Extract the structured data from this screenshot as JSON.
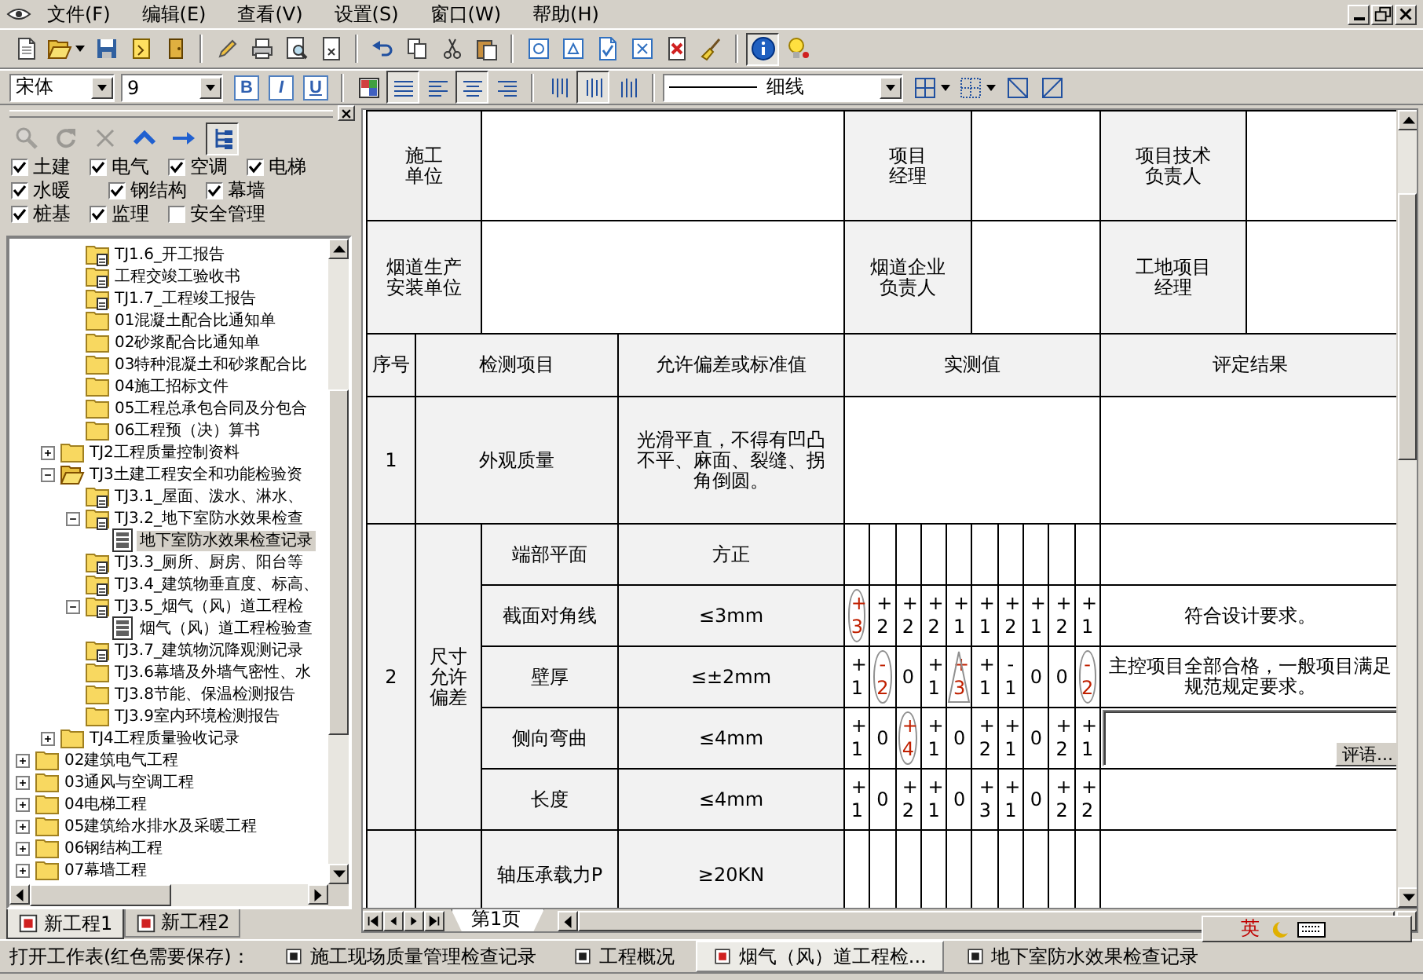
{
  "menu_bar": {
    "items": [
      "文件(F)",
      "编辑(E)",
      "查看(V)",
      "设置(S)",
      "窗口(W)",
      "帮助(H)"
    ]
  },
  "toolbar_main": {
    "groups": [
      [
        {
          "kind": "new-file",
          "pressed": false
        },
        {
          "kind": "open-folder",
          "pressed": false,
          "menu": true
        },
        {
          "kind": "save",
          "pressed": false
        },
        {
          "kind": "note",
          "pressed": false
        },
        {
          "kind": "exit-door",
          "pressed": false
        }
      ],
      [
        {
          "kind": "pencil",
          "pressed": false
        },
        {
          "kind": "print",
          "pressed": false
        },
        {
          "kind": "print-preview",
          "pressed": false
        },
        {
          "kind": "close-file",
          "pressed": false
        }
      ],
      [
        {
          "kind": "undo",
          "pressed": false
        },
        {
          "kind": "copy",
          "pressed": false
        },
        {
          "kind": "cut",
          "pressed": false
        },
        {
          "kind": "paste",
          "pressed": false
        }
      ],
      [
        {
          "kind": "circle-shape",
          "pressed": false
        },
        {
          "kind": "triangle-shape",
          "pressed": false
        },
        {
          "kind": "check-shape"
        },
        {
          "kind": "cross-shape",
          "pressed": false
        },
        {
          "kind": "delete-file",
          "pressed": false
        },
        {
          "kind": "broom",
          "pressed": false
        }
      ],
      [
        {
          "kind": "info",
          "pressed": true
        },
        {
          "kind": "lightbulb",
          "pressed": false
        }
      ]
    ]
  },
  "toolbar_format": {
    "font_box": {
      "value": "宋体"
    },
    "size_box": {
      "value": "9"
    },
    "style_buttons": [
      {
        "label": "B",
        "kind": "bold"
      },
      {
        "label": "I",
        "kind": "italic"
      },
      {
        "label": "U",
        "kind": "underline"
      }
    ],
    "groups": [
      [
        {
          "kind": "cell-color",
          "pressed": false
        },
        {
          "kind": "lines",
          "pressed": true
        },
        {
          "kind": "align-left",
          "pressed": false
        },
        {
          "kind": "align-center",
          "pressed": true
        },
        {
          "kind": "align-right",
          "pressed": false
        }
      ],
      [
        {
          "kind": "valign-top",
          "pressed": false
        },
        {
          "kind": "valign-middle",
          "pressed": true
        },
        {
          "kind": "valign-bottom",
          "pressed": false
        }
      ]
    ],
    "line_box": {
      "value": "细线"
    },
    "border_tools": [
      {
        "kind": "borders",
        "pressed": false,
        "menu": true
      },
      {
        "kind": "dotted-borders",
        "pressed": false,
        "menu": true
      },
      {
        "kind": "diagonal-down",
        "pressed": false
      },
      {
        "kind": "diagonal-up",
        "pressed": false
      }
    ]
  },
  "panel": {
    "tools": [
      {
        "kind": "search",
        "disabled": true,
        "pressed": false
      },
      {
        "kind": "refresh",
        "disabled": true,
        "pressed": false
      },
      {
        "kind": "close",
        "disabled": true,
        "pressed": false
      },
      {
        "kind": "up",
        "disabled": false,
        "pressed": false
      },
      {
        "kind": "forward",
        "disabled": false,
        "pressed": false
      },
      {
        "kind": "tree-view",
        "disabled": false,
        "pressed": true
      }
    ],
    "filter_rows": [
      [
        {
          "label": "土建",
          "checked": true
        },
        {
          "label": "电气",
          "checked": true
        },
        {
          "label": "空调",
          "checked": true
        },
        {
          "label": "电梯",
          "checked": true
        }
      ],
      [
        {
          "label": "水暖",
          "checked": true
        },
        {
          "label": "钢结构",
          "checked": true
        },
        {
          "label": "幕墙",
          "checked": true
        }
      ],
      [
        {
          "label": "桩基",
          "checked": true
        },
        {
          "label": "监理",
          "checked": true
        },
        {
          "label": "安全管理",
          "checked": false
        }
      ]
    ],
    "tree": [
      {
        "children": [
          {
            "children": [
              {
                "label": "TJ1.6_开工报告",
                "kind": "folder-doc",
                "selected": false
              },
              {
                "label": "工程交竣工验收书",
                "kind": "folder-doc",
                "selected": false
              },
              {
                "label": "TJ1.7_工程竣工报告",
                "kind": "folder-doc",
                "selected": false
              },
              {
                "label": "01混凝土配合比通知单",
                "kind": "folder",
                "selected": false
              },
              {
                "label": "02砂浆配合比通知单",
                "kind": "folder",
                "selected": false
              },
              {
                "label": "03特种混凝土和砂浆配合比",
                "kind": "folder",
                "selected": false
              },
              {
                "label": "04施工招标文件",
                "kind": "folder",
                "selected": false
              },
              {
                "label": "05工程总承包合同及分包合",
                "kind": "folder",
                "selected": false
              },
              {
                "label": "06工程预（决）算书",
                "kind": "folder",
                "selected": false
              }
            ]
          },
          {
            "label": "TJ2工程质量控制资料",
            "kind": "folder",
            "selected": false,
            "expanded": false
          },
          {
            "label": "TJ3土建工程安全和功能检验资",
            "kind": "folder-open",
            "selected": false,
            "expanded": true,
            "children": [
              {
                "label": "TJ3.1_屋面、泼水、淋水、",
                "kind": "folder-doc",
                "selected": false
              },
              {
                "label": "TJ3.2_地下室防水效果检查",
                "kind": "folder-doc",
                "selected": false,
                "expanded": true,
                "children": [
                  {
                    "label": "地下室防水效果检查记录",
                    "kind": "sheet",
                    "selected": true
                  }
                ]
              },
              {
                "label": "TJ3.3_厕所、厨房、阳台等",
                "kind": "folder-doc",
                "selected": false
              },
              {
                "label": "TJ3.4_建筑物垂直度、标高、",
                "kind": "folder-doc",
                "selected": false
              },
              {
                "label": "TJ3.5_烟气（风）道工程检",
                "kind": "folder-doc",
                "selected": false,
                "expanded": true,
                "children": [
                  {
                    "label": "烟气（风）道工程检验查",
                    "kind": "sheet",
                    "selected": false
                  }
                ]
              },
              {
                "label": "TJ3.7_建筑物沉降观测记录",
                "kind": "folder-doc",
                "selected": false
              },
              {
                "label": "TJ3.6幕墙及外墙气密性、水",
                "kind": "folder",
                "selected": false
              },
              {
                "label": "TJ3.8节能、保温检测报告",
                "kind": "folder",
                "selected": false
              },
              {
                "label": "TJ3.9室内环境检测报告",
                "kind": "folder",
                "selected": false
              }
            ]
          },
          {
            "label": "TJ4工程质量验收记录",
            "kind": "folder",
            "selected": false,
            "expanded": false
          }
        ]
      },
      {
        "label": "02建筑电气工程",
        "kind": "folder",
        "selected": false,
        "expanded": false
      },
      {
        "label": "03通风与空调工程",
        "kind": "folder",
        "selected": false,
        "expanded": false
      },
      {
        "label": "04电梯工程",
        "kind": "folder",
        "selected": false,
        "expanded": false
      },
      {
        "label": "05建筑给水排水及采暖工程",
        "kind": "folder",
        "selected": false,
        "expanded": false
      },
      {
        "label": "06钢结构工程",
        "kind": "folder",
        "selected": false,
        "expanded": false
      },
      {
        "label": "07幕墙工程",
        "kind": "folder",
        "selected": false,
        "expanded": false
      }
    ],
    "project_tabs": [
      {
        "label": "新工程1",
        "selected": true,
        "unsaved": true
      },
      {
        "label": "新工程2",
        "selected": false,
        "unsaved": true
      }
    ]
  },
  "form": {
    "header_rows": [
      [
        "施工单位",
        "项目经理",
        "项目技术负责人"
      ],
      [
        "烟道生产安装单位",
        "烟道企业负责人",
        "工地项目经理"
      ]
    ],
    "columns": [
      "序号",
      "检测项目",
      "允许偏差或标准值",
      "实测值",
      "评定结果"
    ],
    "items": [
      {
        "no": "1",
        "name": "外观质量",
        "standard": "光滑平直，不得有凹凸不平、麻面、裂缝、拐角倒圆。"
      },
      {
        "no": "2",
        "group": "尺寸允许偏差",
        "rows": [
          {
            "name": "端部平面",
            "standard": "方正"
          },
          {
            "name": "截面对角线",
            "standard": "≤3mm",
            "result": "符合设计要求。",
            "readings": [
              {
                "value": "+3",
                "kind": "circled"
              },
              {
                "value": "+2",
                "kind": "plain"
              },
              {
                "value": "+2",
                "kind": "plain"
              },
              {
                "value": "+2",
                "kind": "plain"
              },
              {
                "value": "+1",
                "kind": "plain"
              },
              {
                "value": "+1",
                "kind": "plain"
              },
              {
                "value": "+2",
                "kind": "plain"
              },
              {
                "value": "+1",
                "kind": "plain"
              },
              {
                "value": "+2",
                "kind": "plain"
              },
              {
                "value": "+1",
                "kind": "plain"
              }
            ]
          },
          {
            "name": "壁厚",
            "standard": "≤±2mm",
            "result": "主控项目全部合格，一般项目满足规范规定要求。",
            "readings": [
              {
                "value": "+1",
                "kind": "plain"
              },
              {
                "value": "-2",
                "kind": "circled"
              },
              {
                "value": "0",
                "kind": "plain"
              },
              {
                "value": "+1",
                "kind": "plain"
              },
              {
                "value": "+3",
                "kind": "triangled"
              },
              {
                "value": "+1",
                "kind": "plain"
              },
              {
                "value": "-1",
                "kind": "plain"
              },
              {
                "value": "0",
                "kind": "plain"
              },
              {
                "value": "0",
                "kind": "plain"
              },
              {
                "value": "-2",
                "kind": "circled"
              }
            ]
          },
          {
            "name": "侧向弯曲",
            "standard": "≤4mm",
            "comment_button": "评语...",
            "readings": [
              {
                "value": "+1",
                "kind": "plain"
              },
              {
                "value": "0",
                "kind": "plain"
              },
              {
                "value": "+4",
                "kind": "circled"
              },
              {
                "value": "+1",
                "kind": "plain"
              },
              {
                "value": "0",
                "kind": "plain"
              },
              {
                "value": "+2",
                "kind": "plain"
              },
              {
                "value": "+1",
                "kind": "plain"
              },
              {
                "value": "0",
                "kind": "plain"
              },
              {
                "value": "+2",
                "kind": "plain"
              },
              {
                "value": "+1",
                "kind": "plain"
              }
            ]
          },
          {
            "name": "长度",
            "standard": "≤4mm",
            "readings": [
              {
                "value": "+1",
                "kind": "plain"
              },
              {
                "value": "0",
                "kind": "plain"
              },
              {
                "value": "+2",
                "kind": "plain"
              },
              {
                "value": "+1",
                "kind": "plain"
              },
              {
                "value": "0",
                "kind": "plain"
              },
              {
                "value": "+3",
                "kind": "plain"
              },
              {
                "value": "+1",
                "kind": "plain"
              },
              {
                "value": "0",
                "kind": "plain"
              },
              {
                "value": "+2",
                "kind": "plain"
              },
              {
                "value": "+2",
                "kind": "plain"
              }
            ]
          }
        ]
      },
      {
        "rows": [
          {
            "name": "轴压承载力P",
            "standard": "≥20KN"
          }
        ]
      }
    ]
  },
  "sheet_tabs": [
    {
      "label": "第1页",
      "selected": true
    }
  ],
  "status_bar": {
    "label": "打开工作表(红色需要保存)：",
    "tabs": [
      {
        "label": "施工现场质量管理检查记录",
        "selected": false,
        "unsaved": false
      },
      {
        "label": "工程概况",
        "selected": false,
        "unsaved": false
      },
      {
        "label": "烟气（风）道工程检...",
        "selected": true,
        "unsaved": true
      },
      {
        "label": "地下室防水效果检查记录",
        "selected": false,
        "unsaved": false
      }
    ]
  },
  "ime_bar": {
    "label": "英"
  }
}
